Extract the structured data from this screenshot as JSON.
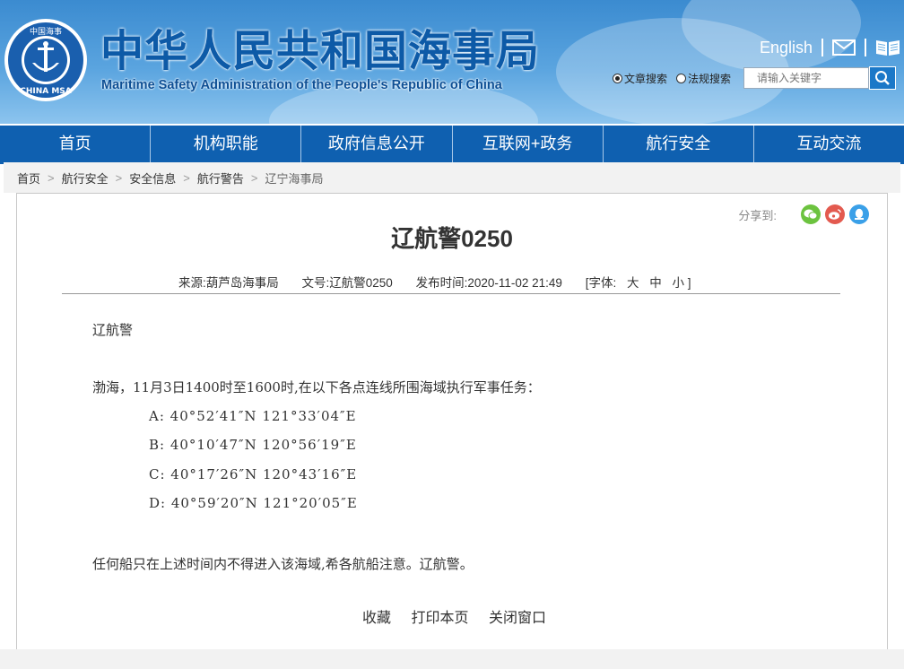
{
  "header": {
    "title_cn": "中华人民共和国海事局",
    "title_en": "Maritime Safety Administration of the People's Republic of China",
    "logo_text_top": "中国海事",
    "logo_text_bottom": "CHINA MSA",
    "english_link": "English",
    "mail_icon": "mail-icon",
    "book_icon": "book-icon",
    "search": {
      "radio_article": "文章搜索",
      "radio_regulation": "法规搜索",
      "placeholder": "请输入关键字"
    }
  },
  "nav": {
    "items": [
      "首页",
      "机构职能",
      "政府信息公开",
      "互联网+政务",
      "航行安全",
      "互动交流"
    ]
  },
  "breadcrumb": [
    "首页",
    "航行安全",
    "安全信息",
    "航行警告",
    "辽宁海事局"
  ],
  "share": {
    "label": "分享到:",
    "icons": [
      "wechat-icon",
      "weibo-icon",
      "qq-icon"
    ],
    "colors": {
      "wechat": "#6cc33f",
      "weibo": "#e35a4f",
      "qq": "#3aa0e8"
    }
  },
  "article": {
    "title": "辽航警0250",
    "source": "来源:葫芦岛海事局",
    "doc_no": "文号:辽航警0250",
    "published": "发布时间:2020-11-02 21:49",
    "font_label": "[字体:",
    "font_large": "大",
    "font_medium": "中",
    "font_small": "小 ]",
    "p1": "辽航警",
    "p2": "渤海，11月3日1400时至1600时,在以下各点连线所围海域执行军事任务：",
    "coords": [
      "A:  40°52′41″N  121°33′04″E",
      "B:  40°10′47″N  120°56′19″E",
      "C:  40°17′26″N  120°43′16″E",
      "D:  40°59′20″N  121°20′05″E"
    ],
    "p3": "任何船只在上述时间内不得进入该海域,希各航船注意。辽航警。"
  },
  "actions": {
    "favorite": "收藏",
    "print": "打印本页",
    "close": "关闭窗口"
  },
  "colors": {
    "nav_bg": "#0f60b0",
    "header_blue": "#0d5aa7"
  }
}
